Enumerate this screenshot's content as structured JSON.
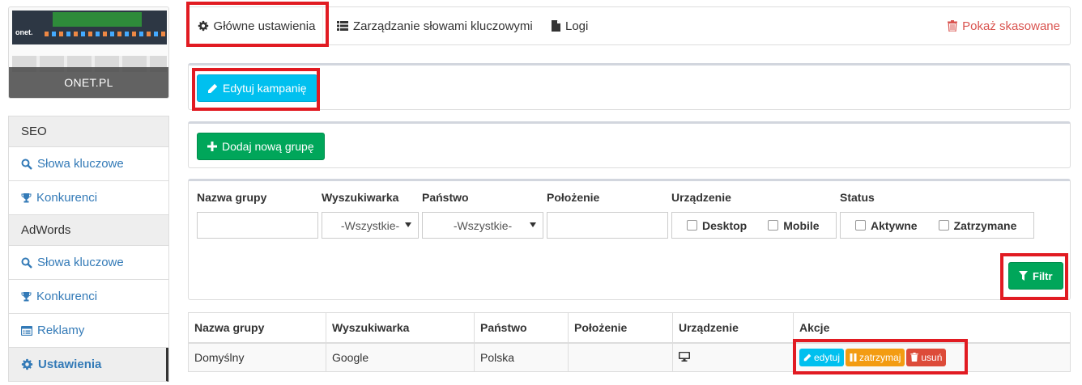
{
  "sidebar": {
    "thumbnail_label": "ONET.PL",
    "thumbnail_logo": "onet.",
    "sections": [
      {
        "header": "SEO",
        "items": [
          {
            "label": "Słowa kluczowe",
            "icon": "search-icon"
          },
          {
            "label": "Konkurenci",
            "icon": "trophy-icon"
          }
        ]
      },
      {
        "header": "AdWords",
        "items": [
          {
            "label": "Słowa kluczowe",
            "icon": "search-icon"
          },
          {
            "label": "Konkurenci",
            "icon": "trophy-icon"
          },
          {
            "label": "Reklamy",
            "icon": "list-alt-icon"
          },
          {
            "label": "Ustawienia",
            "icon": "gear-icon",
            "active": true
          }
        ]
      }
    ]
  },
  "tabs": {
    "main_settings": "Główne ustawienia",
    "keywords_mgmt": "Zarządzanie słowami kluczowymi",
    "logs": "Logi",
    "show_deleted": "Pokaż skasowane"
  },
  "campaign": {
    "edit_label": "Edytuj kampanię"
  },
  "groups": {
    "add_label": "Dodaj nową grupę"
  },
  "filters": {
    "labels": {
      "group_name": "Nazwa grupy",
      "search_engine": "Wyszukiwarka",
      "country": "Państwo",
      "position": "Położenie",
      "device": "Urządzenie",
      "status": "Status"
    },
    "search_engine_value": "-Wszystkie-",
    "country_value": "-Wszystkie-",
    "device_options": [
      "Desktop",
      "Mobile"
    ],
    "status_options": [
      "Aktywne",
      "Zatrzymane"
    ],
    "filter_label": "Filtr"
  },
  "table": {
    "headers": [
      "Nazwa grupy",
      "Wyszukiwarka",
      "Państwo",
      "Położenie",
      "Urządzenie",
      "Akcje"
    ],
    "rows": [
      {
        "name": "Domyślny",
        "engine": "Google",
        "country": "Polska",
        "position": "",
        "device": "desktop-icon"
      }
    ],
    "actions": {
      "edit": "edytuj",
      "pause": "zatrzymaj",
      "delete": "usuń"
    }
  },
  "colors": {
    "accent_link": "#337ab7",
    "info": "#00c0ef",
    "success": "#00a65a",
    "warning": "#f39c12",
    "danger": "#dd4b39",
    "highlight": "#e11b22"
  }
}
